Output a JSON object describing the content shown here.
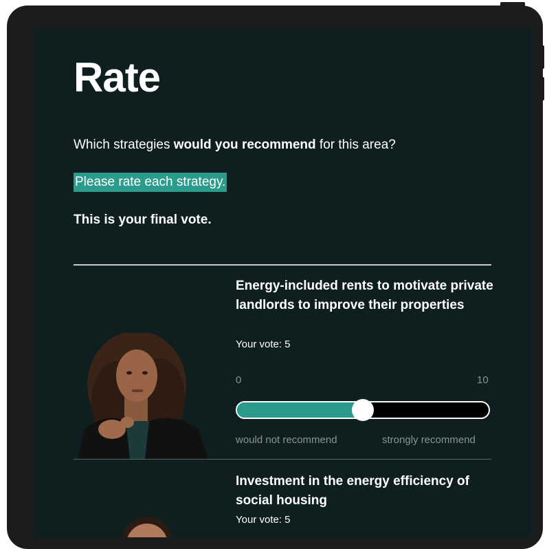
{
  "page": {
    "title": "Rate",
    "question_pre": "Which strategies ",
    "question_bold": "would you recommend",
    "question_post": " for this area?",
    "instruction": "Please rate each strategy.",
    "final_vote": "This is your final vote."
  },
  "strategies": [
    {
      "title": "Energy-included rents to motivate private landlords to improve their properties",
      "vote_label": "Your vote: 5",
      "vote_value": 5,
      "scale_min_label": "0",
      "scale_max_label": "10",
      "scale_min": 0,
      "scale_max": 10,
      "min_caption": "would not recommend",
      "max_caption": "strongly recommend",
      "portrait": "woman-speaker-portrait"
    },
    {
      "title": "Investment in the energy efficiency of social housing",
      "vote_label": "Your vote: 5",
      "vote_value": 5,
      "portrait": "man-speaker-portrait"
    }
  ],
  "colors": {
    "device_frame": "#1b1c1c",
    "screen_bg": "#0f1f1f",
    "accent_teal": "#2b9b8c",
    "divider": "#c9cccc",
    "muted_text": "#8a9494"
  }
}
